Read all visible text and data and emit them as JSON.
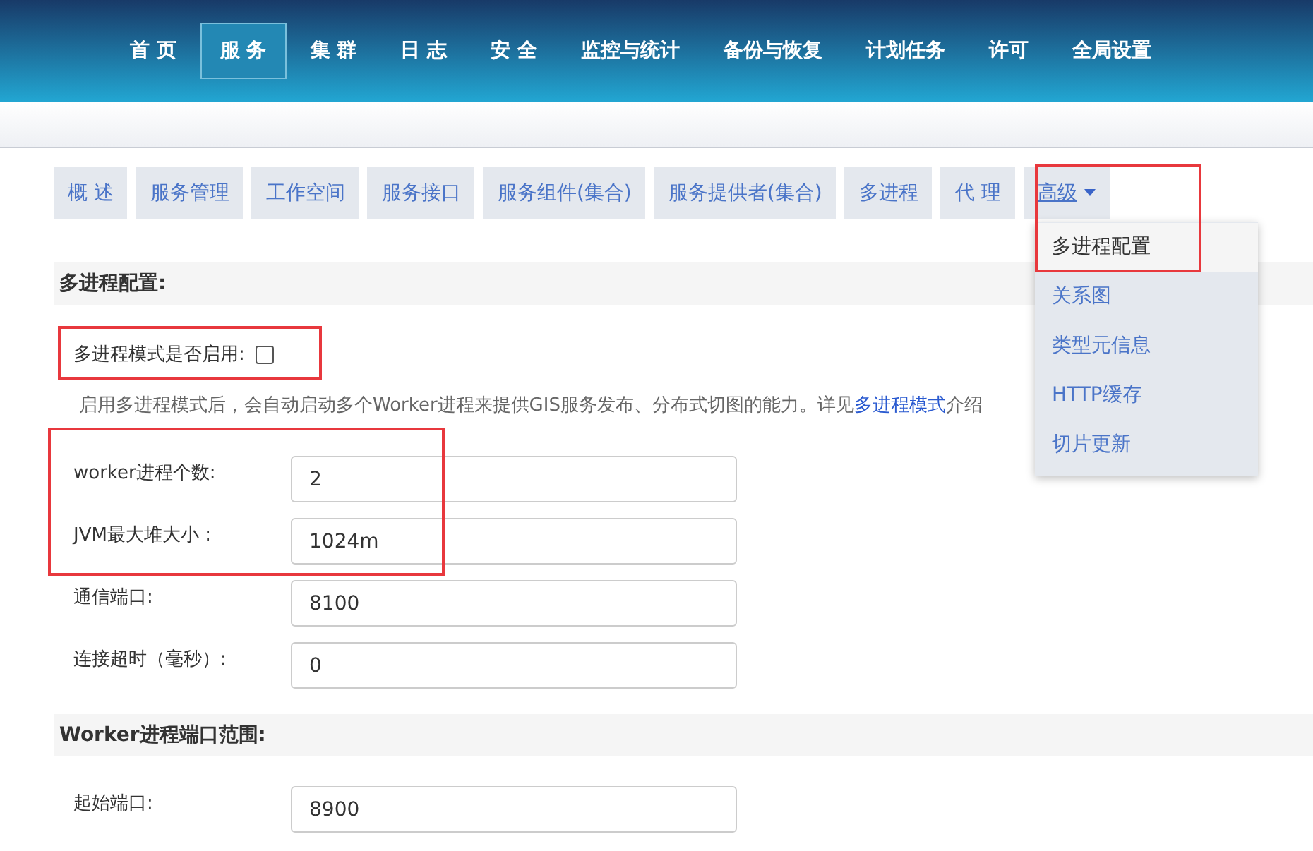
{
  "nav": [
    {
      "label": "首 页",
      "selected": false
    },
    {
      "label": "服 务",
      "selected": true
    },
    {
      "label": "集 群",
      "selected": false
    },
    {
      "label": "日 志",
      "selected": false
    },
    {
      "label": "安 全",
      "selected": false
    },
    {
      "label": "监控与统计",
      "selected": false
    },
    {
      "label": "备份与恢复",
      "selected": false
    },
    {
      "label": "计划任务",
      "selected": false
    },
    {
      "label": "许可",
      "selected": false
    },
    {
      "label": "全局设置",
      "selected": false
    }
  ],
  "tabs": [
    {
      "label": "概 述",
      "dropdown": false
    },
    {
      "label": "服务管理",
      "dropdown": false
    },
    {
      "label": "工作空间",
      "dropdown": false
    },
    {
      "label": "服务接口",
      "dropdown": false
    },
    {
      "label": "服务组件(集合)",
      "dropdown": false
    },
    {
      "label": "服务提供者(集合)",
      "dropdown": false
    },
    {
      "label": "多进程",
      "dropdown": false
    },
    {
      "label": "代 理",
      "dropdown": false
    },
    {
      "label": "高级",
      "dropdown": true
    }
  ],
  "menu": [
    {
      "label": "多进程配置",
      "selected": true
    },
    {
      "label": "关系图",
      "selected": false
    },
    {
      "label": "类型元信息",
      "selected": false
    },
    {
      "label": "HTTP缓存",
      "selected": false
    },
    {
      "label": "切片更新",
      "selected": false
    }
  ],
  "section1": {
    "title": "多进程配置:",
    "toggle_label": "多进程模式是否启用:",
    "toggle_checked": false,
    "description": "启用多进程模式后，会自动启动多个Worker进程来提供GIS服务发布、分布式切图的能力。详见",
    "link": "多进程模式",
    "description_end": "介绍",
    "fields": [
      {
        "label": "worker进程个数:",
        "value": "2"
      },
      {
        "label": "JVM最大堆大小 :",
        "value": "1024m"
      },
      {
        "label": "通信端口:",
        "value": "8100"
      },
      {
        "label": "连接超时（毫秒）:",
        "value": "0"
      }
    ]
  },
  "section2": {
    "title": "Worker进程端口范围:",
    "fields": [
      {
        "label": "起始端口:",
        "value": "8900"
      }
    ]
  },
  "callouts": [
    {
      "kind": "menu"
    },
    {
      "kind": "toggle"
    },
    {
      "kind": "fields"
    }
  ]
}
